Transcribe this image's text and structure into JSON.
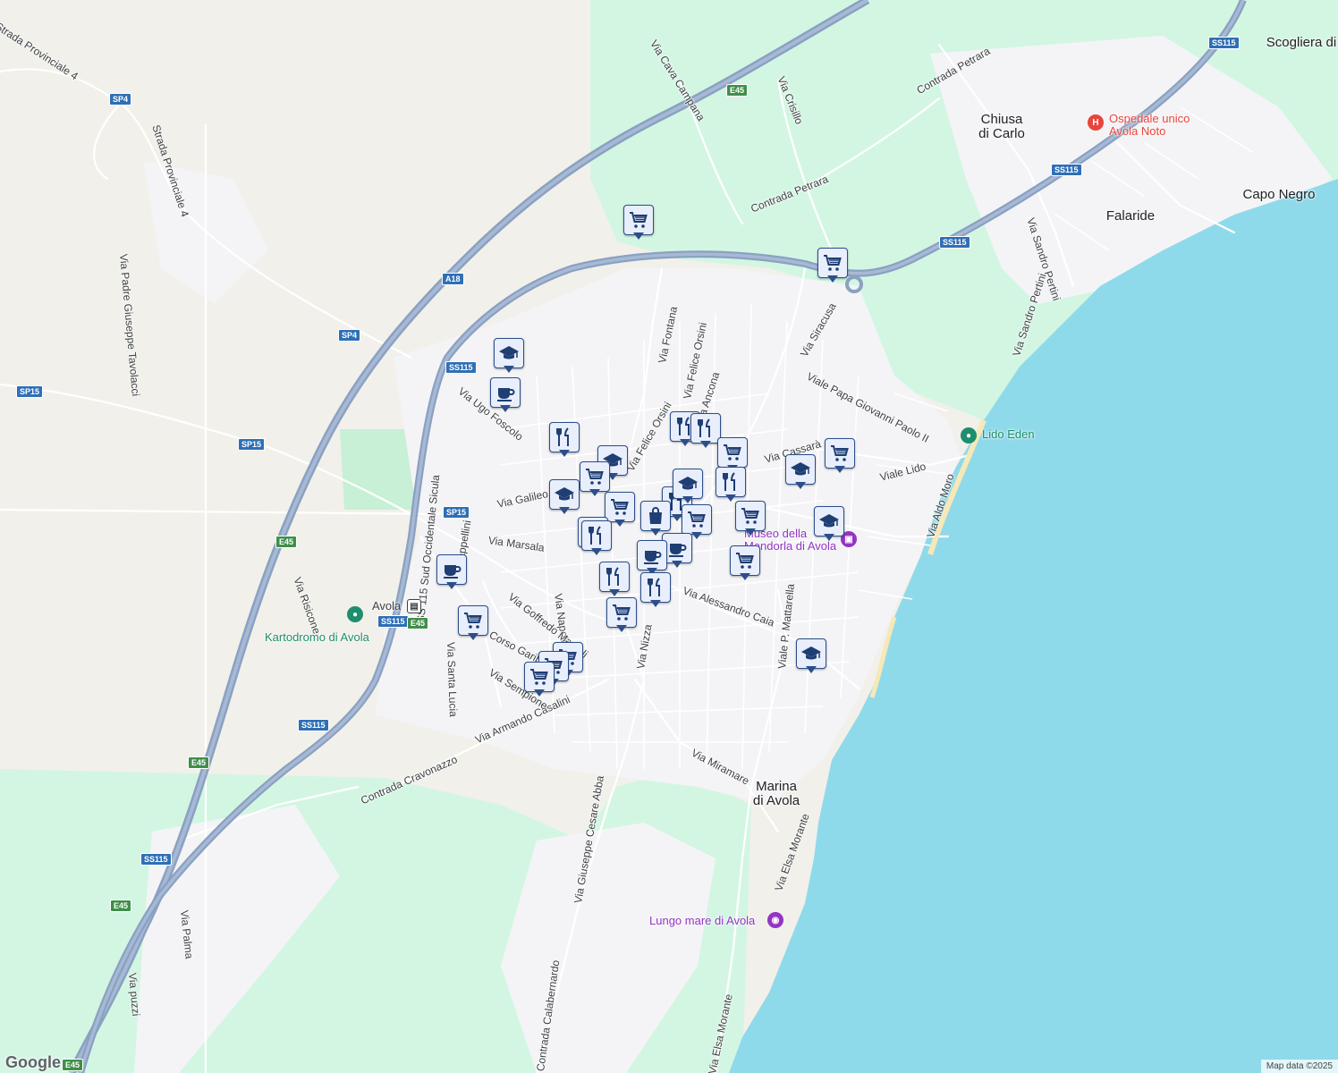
{
  "map": {
    "attribution": "Map data ©2025",
    "logo": "Google",
    "colors": {
      "water": "#8fdaea",
      "park": "#d3f6e3",
      "land": "#f2f0ea",
      "urban": "#f4f4f6",
      "motorway": "#8aa1c2",
      "road": "#ffffff",
      "marker": "#2c4e8a",
      "marker_fill": "#e8eefb"
    },
    "places": [
      {
        "id": "chiusa",
        "text": "Chiusa\ndi Carlo"
      },
      {
        "id": "falaride",
        "text": "Falaride"
      },
      {
        "id": "capo-negro",
        "text": "Capo Negro"
      },
      {
        "id": "marina",
        "text": "Marina\ndi Avola"
      },
      {
        "id": "scogliera",
        "text": "Scogliera di"
      }
    ],
    "pois": [
      {
        "id": "hospital",
        "text": "Ospedale unico\nAvola Noto",
        "icon": "hospital-icon",
        "color": "#e8453c"
      },
      {
        "id": "lido-eden",
        "text": "Lido Eden",
        "icon": "leisure-icon",
        "color": "#1e8e6e"
      },
      {
        "id": "kartodromo",
        "text": "Kartodromo di Avola",
        "icon": "leisure-icon",
        "color": "#1e8e6e"
      },
      {
        "id": "museo",
        "text": "Museo della\nMandorla di Avola",
        "icon": "museum-icon",
        "color": "#9334c4"
      },
      {
        "id": "lungomare",
        "text": "Lungo mare di Avola",
        "icon": "camera-icon",
        "color": "#9334c4"
      },
      {
        "id": "avola-station",
        "text": "Avola",
        "icon": "train-icon",
        "color": "#3c4043"
      }
    ],
    "streets": [
      "Strada Provinciale 4",
      "Strada Provinciale 4",
      "Via Padre Giuseppe Tavolacci",
      "Via Cava Campana",
      "Via Crisillo",
      "Contrada Petrara",
      "Contrada Petrara",
      "Via Sandro Pertini",
      "Via Sandro Pertini",
      "Via Fontana",
      "Via Felice Orsini",
      "Via Ancona",
      "Via Siracusa",
      "Viale Papa Giovanni Paolo II",
      "Via Ugo Foscolo",
      "Via Galileo",
      "Via Marsala",
      "Via Cappellini",
      "SS 115 Sud Occidentale Sicula",
      "Via Risicone",
      "Via Napoli",
      "Via Goffredo Mameli",
      "Corso Garibaldi",
      "Via Santa Lucia",
      "Via Nizza",
      "Via Alessandro Caia",
      "Viale P. Mattarella",
      "Viale Lido",
      "Via Aldo Moro",
      "Via Cassarà",
      "Contrada Cravonazzo",
      "Via Armando Casalini",
      "Via Miramare",
      "Via Giuseppe Cesare Abba",
      "Contrada Calabernardo",
      "Via Elsa Morante",
      "Via Elsa Morante",
      "Via Palma",
      "Via puzzi",
      "Via Felice Orsini",
      "Via Sempione"
    ],
    "shields": [
      "SP4",
      "SP4",
      "SP15",
      "SP15",
      "SP15",
      "A18",
      "SS115",
      "SS115",
      "SS115",
      "SS115",
      "SS115",
      "SS115",
      "SS115",
      "E45",
      "E45",
      "E45",
      "E45",
      "E45",
      "E45"
    ],
    "markers": [
      {
        "type": "shopping-cart-icon"
      },
      {
        "type": "shopping-cart-icon"
      },
      {
        "type": "school-icon"
      },
      {
        "type": "cafe-icon"
      },
      {
        "type": "restaurant-icon"
      },
      {
        "type": "restaurant-icon"
      },
      {
        "type": "restaurant-icon"
      },
      {
        "type": "shopping-cart-icon"
      },
      {
        "type": "school-icon"
      },
      {
        "type": "school-icon"
      },
      {
        "type": "shopping-cart-icon"
      },
      {
        "type": "shopping-cart-icon"
      },
      {
        "type": "school-icon"
      },
      {
        "type": "shopping-cart-icon"
      },
      {
        "type": "restaurant-icon"
      },
      {
        "type": "school-icon"
      },
      {
        "type": "shopping-cart-icon"
      },
      {
        "type": "shopping-bag-icon"
      },
      {
        "type": "restaurant-icon"
      },
      {
        "type": "shopping-cart-icon"
      },
      {
        "type": "restaurant-icon"
      },
      {
        "type": "cafe-icon"
      },
      {
        "type": "cafe-icon"
      },
      {
        "type": "school-icon"
      },
      {
        "type": "restaurant-icon"
      },
      {
        "type": "restaurant-icon"
      },
      {
        "type": "shopping-cart-icon"
      },
      {
        "type": "cafe-icon"
      },
      {
        "type": "shopping-cart-icon"
      },
      {
        "type": "shopping-cart-icon"
      },
      {
        "type": "shopping-cart-icon"
      },
      {
        "type": "shopping-cart-icon"
      },
      {
        "type": "school-icon"
      },
      {
        "type": "shopping-cart-icon"
      },
      {
        "type": "restaurant-icon"
      }
    ]
  }
}
